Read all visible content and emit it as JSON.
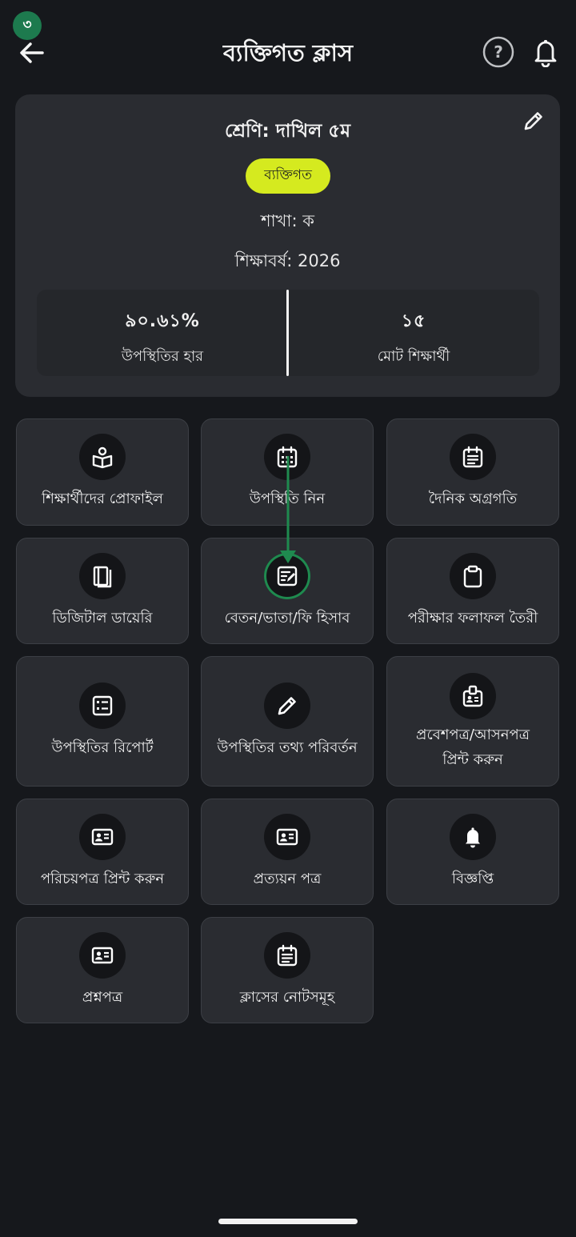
{
  "status": {
    "badge_number": "৩"
  },
  "header": {
    "title": "ব্যক্তিগত ক্লাস"
  },
  "class_info": {
    "class_name": "শ্রেণি: দাখিল ৫ম",
    "type_pill": "ব্যক্তিগত",
    "section": "শাখা: ক",
    "year": "শিক্ষাবর্ষ: 2026",
    "stats": [
      {
        "value": "৯০.৬১%",
        "label": "উপস্থিতির হার"
      },
      {
        "value": "১৫",
        "label": "মোট শিক্ষার্থী"
      }
    ]
  },
  "menu": [
    {
      "label": "শিক্ষার্থীদের প্রোফাইল",
      "icon": "student-profile-icon"
    },
    {
      "label": "উপস্থিতি নিন",
      "icon": "calendar-grid-icon"
    },
    {
      "label": "দৈনিক অগ্রগতি",
      "icon": "calendar-list-icon"
    },
    {
      "label": "ডিজিটাল ডায়েরি",
      "icon": "diary-book-icon"
    },
    {
      "label": "বেতন/ভাতা/ফি হিসাব",
      "icon": "note-edit-icon"
    },
    {
      "label": "পরীক্ষার ফলাফল তৈরী",
      "icon": "clipboard-icon"
    },
    {
      "label": "উপস্থিতির রিপোর্ট",
      "icon": "list-report-icon"
    },
    {
      "label": "উপস্থিতির তথ্য পরিবর্তন",
      "icon": "pencil-icon"
    },
    {
      "label_line1": "প্রবেশপত্র/আসনপত্র",
      "label_line2": "প্রিন্ট করুন",
      "icon": "id-badge-icon"
    },
    {
      "label": "পরিচয়পত্র প্রিন্ট করুন",
      "icon": "id-card-icon"
    },
    {
      "label": "প্রত্যয়ন পত্র",
      "icon": "id-card-icon"
    },
    {
      "label": "বিজ্ঞপ্তি",
      "icon": "bell-icon"
    },
    {
      "label": "প্রশ্নপত্র",
      "icon": "id-card-icon"
    },
    {
      "label": "ক্লাসের নোটসমূহ",
      "icon": "notes-calendar-icon"
    }
  ],
  "colors": {
    "background": "#16181c",
    "card": "#2a2c31",
    "accent_pill": "#d5ea1f",
    "badge": "#1d7a4e",
    "pointer": "#1f8a4f"
  }
}
